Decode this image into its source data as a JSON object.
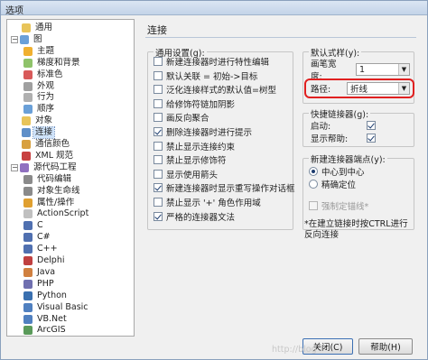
{
  "window": {
    "title": "选项"
  },
  "tree": [
    {
      "label": "通用",
      "level": 0,
      "expander": "",
      "icon": "#e8c45a",
      "icon_name": "general-icon"
    },
    {
      "label": "图",
      "level": 0,
      "expander": "⊟",
      "icon": "#6aa0d8",
      "icon_name": "diagram-icon"
    },
    {
      "label": "主题",
      "level": 1,
      "expander": "",
      "icon": "#f0b030",
      "icon_name": "theme-icon"
    },
    {
      "label": "梯度和背景",
      "level": 1,
      "expander": "",
      "icon": "#8fc36a",
      "icon_name": "gradient-icon"
    },
    {
      "label": "标准色",
      "level": 1,
      "expander": "",
      "icon": "#d85a5a",
      "icon_name": "color-icon"
    },
    {
      "label": "外观",
      "level": 1,
      "expander": "",
      "icon": "#a0a0a0",
      "icon_name": "appearance-icon"
    },
    {
      "label": "行为",
      "level": 1,
      "expander": "",
      "icon": "#b0b0b0",
      "icon_name": "behavior-icon"
    },
    {
      "label": "顺序",
      "level": 1,
      "expander": "",
      "icon": "#6aa0d8",
      "icon_name": "order-icon"
    },
    {
      "label": "对象",
      "level": 0,
      "expander": "",
      "icon": "#e8c45a",
      "icon_name": "object-icon"
    },
    {
      "label": "连接",
      "level": 0,
      "expander": "",
      "icon": "#5f8fc8",
      "icon_name": "connector-icon"
    },
    {
      "label": "通信颜色",
      "level": 0,
      "expander": "",
      "icon": "#d8a040",
      "icon_name": "comm-color-icon"
    },
    {
      "label": "XML 规范",
      "level": 0,
      "expander": "",
      "icon": "#c84040",
      "icon_name": "xml-icon"
    },
    {
      "label": "源代码工程",
      "level": 0,
      "expander": "⊟",
      "icon": "#9070c0",
      "icon_name": "source-icon"
    },
    {
      "label": "代码编辑",
      "level": 1,
      "expander": "",
      "icon": "#8a8a8a",
      "icon_name": "code-edit-icon"
    },
    {
      "label": "对象生命线",
      "level": 1,
      "expander": "",
      "icon": "#8a8a8a",
      "icon_name": "lifeline-icon"
    },
    {
      "label": "属性/操作",
      "level": 1,
      "expander": "",
      "icon": "#e0a030",
      "icon_name": "attribute-icon"
    },
    {
      "label": "ActionScript",
      "level": 1,
      "expander": "",
      "icon": "#c0c0c0",
      "icon_name": "actionscript-icon"
    },
    {
      "label": "C",
      "level": 1,
      "expander": "",
      "icon": "#5070b0",
      "icon_name": "c-icon"
    },
    {
      "label": "C#",
      "level": 1,
      "expander": "",
      "icon": "#5070b0",
      "icon_name": "csharp-icon"
    },
    {
      "label": "C++",
      "level": 1,
      "expander": "",
      "icon": "#5070b0",
      "icon_name": "cpp-icon"
    },
    {
      "label": "Delphi",
      "level": 1,
      "expander": "",
      "icon": "#c04040",
      "icon_name": "delphi-icon"
    },
    {
      "label": "Java",
      "level": 1,
      "expander": "",
      "icon": "#d08040",
      "icon_name": "java-icon"
    },
    {
      "label": "PHP",
      "level": 1,
      "expander": "",
      "icon": "#7070b0",
      "icon_name": "php-icon"
    },
    {
      "label": "Python",
      "level": 1,
      "expander": "",
      "icon": "#3a70b0",
      "icon_name": "python-icon"
    },
    {
      "label": "Visual Basic",
      "level": 1,
      "expander": "",
      "icon": "#5080c0",
      "icon_name": "vb-icon"
    },
    {
      "label": "VB.Net",
      "level": 1,
      "expander": "",
      "icon": "#5080c0",
      "icon_name": "vbnet-icon"
    },
    {
      "label": "ArcGIS",
      "level": 1,
      "expander": "",
      "icon": "#5a9a5a",
      "icon_name": "arcgis-icon"
    }
  ],
  "tree_selected": "连接",
  "panel": {
    "heading": "连接",
    "general": {
      "legend": "通用设置(g):",
      "options": [
        {
          "label": "新建连接器时进行特性编辑",
          "checked": false,
          "disabled": false
        },
        {
          "label": "默认关联 = 初始->目标",
          "checked": false,
          "disabled": false
        },
        {
          "label": "泛化连接样式的默认值=树型",
          "checked": false,
          "disabled": false
        },
        {
          "label": "给修饰符链加阴影",
          "checked": false,
          "disabled": false
        },
        {
          "label": "画反向聚合",
          "checked": false,
          "disabled": false
        },
        {
          "label": "删除连接器时进行提示",
          "checked": true,
          "disabled": false
        },
        {
          "label": "禁止显示连接约束",
          "checked": false,
          "disabled": false
        },
        {
          "label": "禁止显示修饰符",
          "checked": false,
          "disabled": false
        },
        {
          "label": "显示使用箭头",
          "checked": false,
          "disabled": false
        },
        {
          "label": "新建连接器时显示重写操作对话框",
          "checked": true,
          "disabled": false
        },
        {
          "label": "禁止显示 '+' 角色作用域",
          "checked": false,
          "disabled": false
        },
        {
          "label": "严格的连接器文法",
          "checked": true,
          "disabled": false
        }
      ]
    },
    "default_style": {
      "legend": "默认式样(y):",
      "width_label": "画笔宽度:",
      "width_value": "1",
      "path_label": "路径:",
      "path_value": "折线"
    },
    "quick_linker": {
      "legend": "快捷链接器(g):",
      "items": [
        {
          "label": "启动:",
          "checked": true
        },
        {
          "label": "显示帮助:",
          "checked": true
        }
      ]
    },
    "endpoint": {
      "legend": "新建连接器端点(y):",
      "radios": [
        {
          "label": "中心到中心",
          "on": true
        },
        {
          "label": "精确定位",
          "on": false
        }
      ],
      "force_label": "强制定锚线*"
    },
    "note": "*在建立链接时按CTRL进行反向连接"
  },
  "buttons": {
    "close": "关闭(C)",
    "help": "帮助(H)"
  },
  "watermark": "http://blog"
}
